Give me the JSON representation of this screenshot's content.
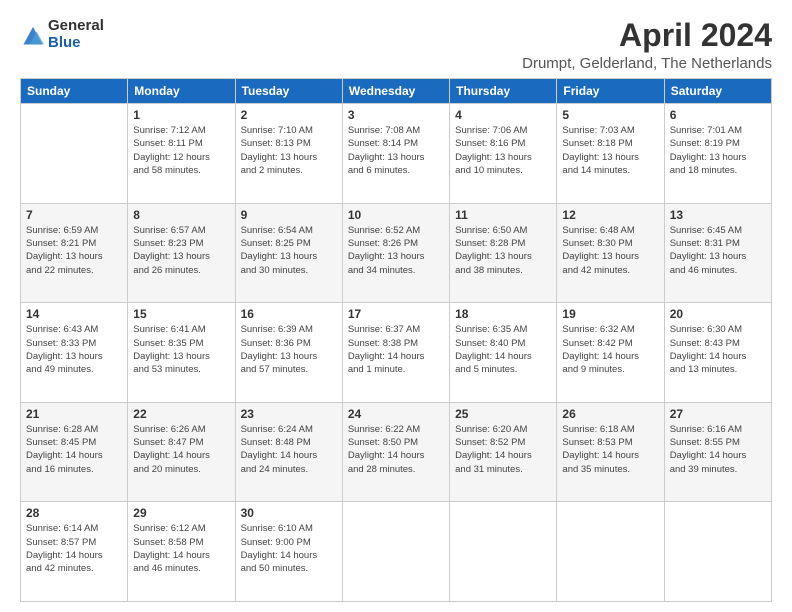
{
  "logo": {
    "general": "General",
    "blue": "Blue"
  },
  "title": "April 2024",
  "subtitle": "Drumpt, Gelderland, The Netherlands",
  "days_of_week": [
    "Sunday",
    "Monday",
    "Tuesday",
    "Wednesday",
    "Thursday",
    "Friday",
    "Saturday"
  ],
  "weeks": [
    [
      {
        "day": "",
        "info": ""
      },
      {
        "day": "1",
        "info": "Sunrise: 7:12 AM\nSunset: 8:11 PM\nDaylight: 12 hours\nand 58 minutes."
      },
      {
        "day": "2",
        "info": "Sunrise: 7:10 AM\nSunset: 8:13 PM\nDaylight: 13 hours\nand 2 minutes."
      },
      {
        "day": "3",
        "info": "Sunrise: 7:08 AM\nSunset: 8:14 PM\nDaylight: 13 hours\nand 6 minutes."
      },
      {
        "day": "4",
        "info": "Sunrise: 7:06 AM\nSunset: 8:16 PM\nDaylight: 13 hours\nand 10 minutes."
      },
      {
        "day": "5",
        "info": "Sunrise: 7:03 AM\nSunset: 8:18 PM\nDaylight: 13 hours\nand 14 minutes."
      },
      {
        "day": "6",
        "info": "Sunrise: 7:01 AM\nSunset: 8:19 PM\nDaylight: 13 hours\nand 18 minutes."
      }
    ],
    [
      {
        "day": "7",
        "info": "Sunrise: 6:59 AM\nSunset: 8:21 PM\nDaylight: 13 hours\nand 22 minutes."
      },
      {
        "day": "8",
        "info": "Sunrise: 6:57 AM\nSunset: 8:23 PM\nDaylight: 13 hours\nand 26 minutes."
      },
      {
        "day": "9",
        "info": "Sunrise: 6:54 AM\nSunset: 8:25 PM\nDaylight: 13 hours\nand 30 minutes."
      },
      {
        "day": "10",
        "info": "Sunrise: 6:52 AM\nSunset: 8:26 PM\nDaylight: 13 hours\nand 34 minutes."
      },
      {
        "day": "11",
        "info": "Sunrise: 6:50 AM\nSunset: 8:28 PM\nDaylight: 13 hours\nand 38 minutes."
      },
      {
        "day": "12",
        "info": "Sunrise: 6:48 AM\nSunset: 8:30 PM\nDaylight: 13 hours\nand 42 minutes."
      },
      {
        "day": "13",
        "info": "Sunrise: 6:45 AM\nSunset: 8:31 PM\nDaylight: 13 hours\nand 46 minutes."
      }
    ],
    [
      {
        "day": "14",
        "info": "Sunrise: 6:43 AM\nSunset: 8:33 PM\nDaylight: 13 hours\nand 49 minutes."
      },
      {
        "day": "15",
        "info": "Sunrise: 6:41 AM\nSunset: 8:35 PM\nDaylight: 13 hours\nand 53 minutes."
      },
      {
        "day": "16",
        "info": "Sunrise: 6:39 AM\nSunset: 8:36 PM\nDaylight: 13 hours\nand 57 minutes."
      },
      {
        "day": "17",
        "info": "Sunrise: 6:37 AM\nSunset: 8:38 PM\nDaylight: 14 hours\nand 1 minute."
      },
      {
        "day": "18",
        "info": "Sunrise: 6:35 AM\nSunset: 8:40 PM\nDaylight: 14 hours\nand 5 minutes."
      },
      {
        "day": "19",
        "info": "Sunrise: 6:32 AM\nSunset: 8:42 PM\nDaylight: 14 hours\nand 9 minutes."
      },
      {
        "day": "20",
        "info": "Sunrise: 6:30 AM\nSunset: 8:43 PM\nDaylight: 14 hours\nand 13 minutes."
      }
    ],
    [
      {
        "day": "21",
        "info": "Sunrise: 6:28 AM\nSunset: 8:45 PM\nDaylight: 14 hours\nand 16 minutes."
      },
      {
        "day": "22",
        "info": "Sunrise: 6:26 AM\nSunset: 8:47 PM\nDaylight: 14 hours\nand 20 minutes."
      },
      {
        "day": "23",
        "info": "Sunrise: 6:24 AM\nSunset: 8:48 PM\nDaylight: 14 hours\nand 24 minutes."
      },
      {
        "day": "24",
        "info": "Sunrise: 6:22 AM\nSunset: 8:50 PM\nDaylight: 14 hours\nand 28 minutes."
      },
      {
        "day": "25",
        "info": "Sunrise: 6:20 AM\nSunset: 8:52 PM\nDaylight: 14 hours\nand 31 minutes."
      },
      {
        "day": "26",
        "info": "Sunrise: 6:18 AM\nSunset: 8:53 PM\nDaylight: 14 hours\nand 35 minutes."
      },
      {
        "day": "27",
        "info": "Sunrise: 6:16 AM\nSunset: 8:55 PM\nDaylight: 14 hours\nand 39 minutes."
      }
    ],
    [
      {
        "day": "28",
        "info": "Sunrise: 6:14 AM\nSunset: 8:57 PM\nDaylight: 14 hours\nand 42 minutes."
      },
      {
        "day": "29",
        "info": "Sunrise: 6:12 AM\nSunset: 8:58 PM\nDaylight: 14 hours\nand 46 minutes."
      },
      {
        "day": "30",
        "info": "Sunrise: 6:10 AM\nSunset: 9:00 PM\nDaylight: 14 hours\nand 50 minutes."
      },
      {
        "day": "",
        "info": ""
      },
      {
        "day": "",
        "info": ""
      },
      {
        "day": "",
        "info": ""
      },
      {
        "day": "",
        "info": ""
      }
    ]
  ]
}
